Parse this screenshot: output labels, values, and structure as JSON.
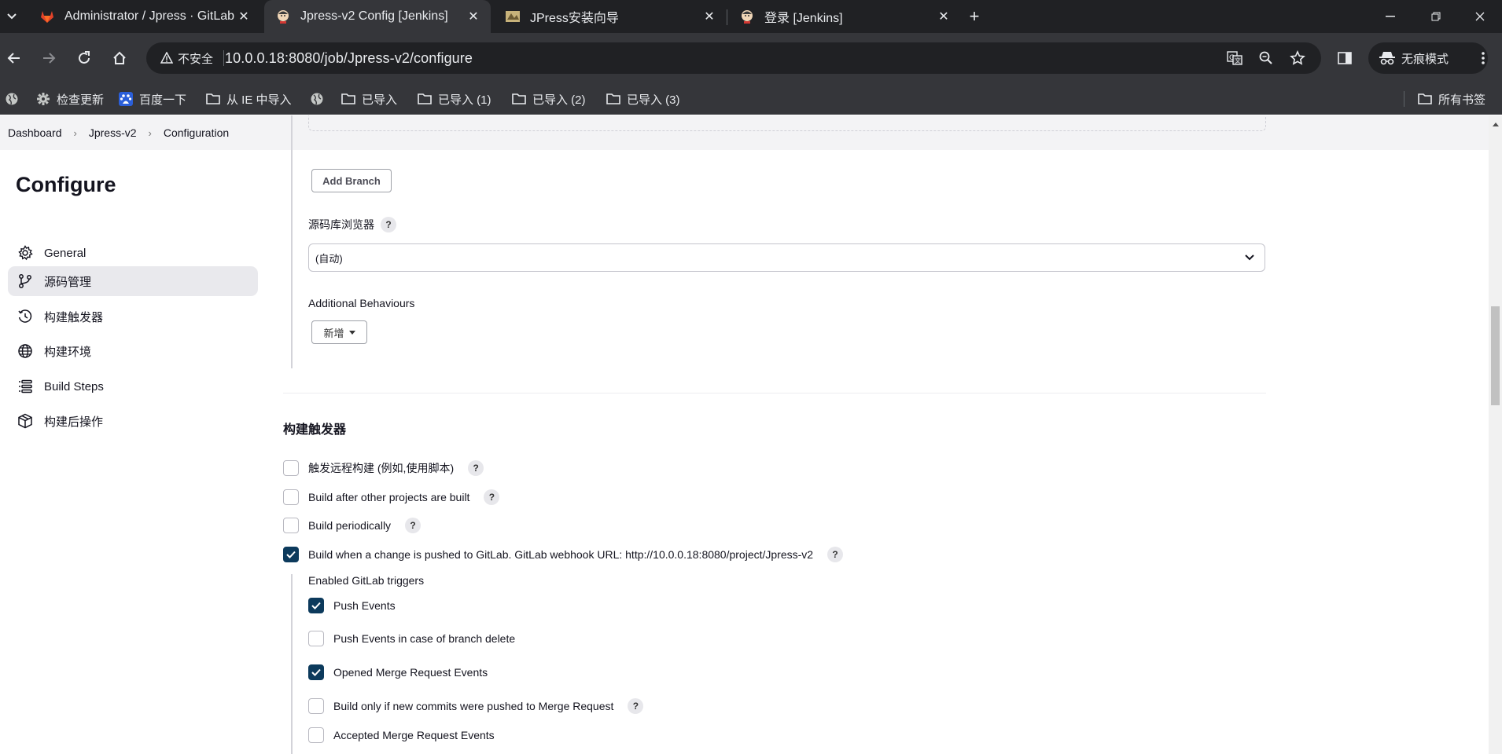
{
  "browser": {
    "tabs": [
      {
        "title": "Administrator / Jpress · GitLab",
        "icon": "gitlab-icon"
      },
      {
        "title": "Jpress-v2 Config [Jenkins]",
        "icon": "jenkins-icon",
        "active": true
      },
      {
        "title": "JPress安装向导",
        "icon": "jpress-icon"
      },
      {
        "title": "登录 [Jenkins]",
        "icon": "jenkins-icon"
      }
    ],
    "security_label": "不安全",
    "url": "10.0.0.18:8080/job/Jpress-v2/configure",
    "incognito_label": "无痕模式",
    "bookmarks": [
      "检查更新",
      "百度一下",
      "从 IE 中导入",
      "已导入",
      "已导入 (1)",
      "已导入 (2)",
      "已导入 (3)"
    ],
    "all_bookmarks": "所有书签"
  },
  "breadcrumb": [
    "Dashboard",
    "Jpress-v2",
    "Configuration"
  ],
  "sidebar": {
    "title": "Configure",
    "items": [
      {
        "label": "General",
        "icon": "gear-icon"
      },
      {
        "label": "源码管理",
        "icon": "branch-icon",
        "active": true
      },
      {
        "label": "构建触发器",
        "icon": "clock-icon"
      },
      {
        "label": "构建环境",
        "icon": "globe-icon"
      },
      {
        "label": "Build Steps",
        "icon": "list-icon"
      },
      {
        "label": "构建后操作",
        "icon": "cube-icon"
      }
    ]
  },
  "scm": {
    "add_branch": "Add Branch",
    "repo_browser_label": "源码库浏览器",
    "repo_browser_value": "(自动)",
    "additional_behaviours": "Additional Behaviours",
    "add_button": "新增"
  },
  "triggers": {
    "title": "构建触发器",
    "options": [
      {
        "label": "触发远程构建 (例如,使用脚本)",
        "checked": false
      },
      {
        "label": "Build after other projects are built",
        "checked": false
      },
      {
        "label": "Build periodically",
        "checked": false
      },
      {
        "label": "Build when a change is pushed to GitLab. GitLab webhook URL: http://10.0.0.18:8080/project/Jpress-v2",
        "checked": true
      }
    ],
    "gitlab_triggers_label": "Enabled GitLab triggers",
    "gitlab_triggers": [
      {
        "label": "Push Events",
        "checked": true
      },
      {
        "label": "Push Events in case of branch delete",
        "checked": false
      },
      {
        "label": "Opened Merge Request Events",
        "checked": true
      },
      {
        "label": "Build only if new commits were pushed to Merge Request",
        "checked": false
      },
      {
        "label": "Accepted Merge Request Events",
        "checked": false
      }
    ]
  },
  "help_glyph": "?"
}
